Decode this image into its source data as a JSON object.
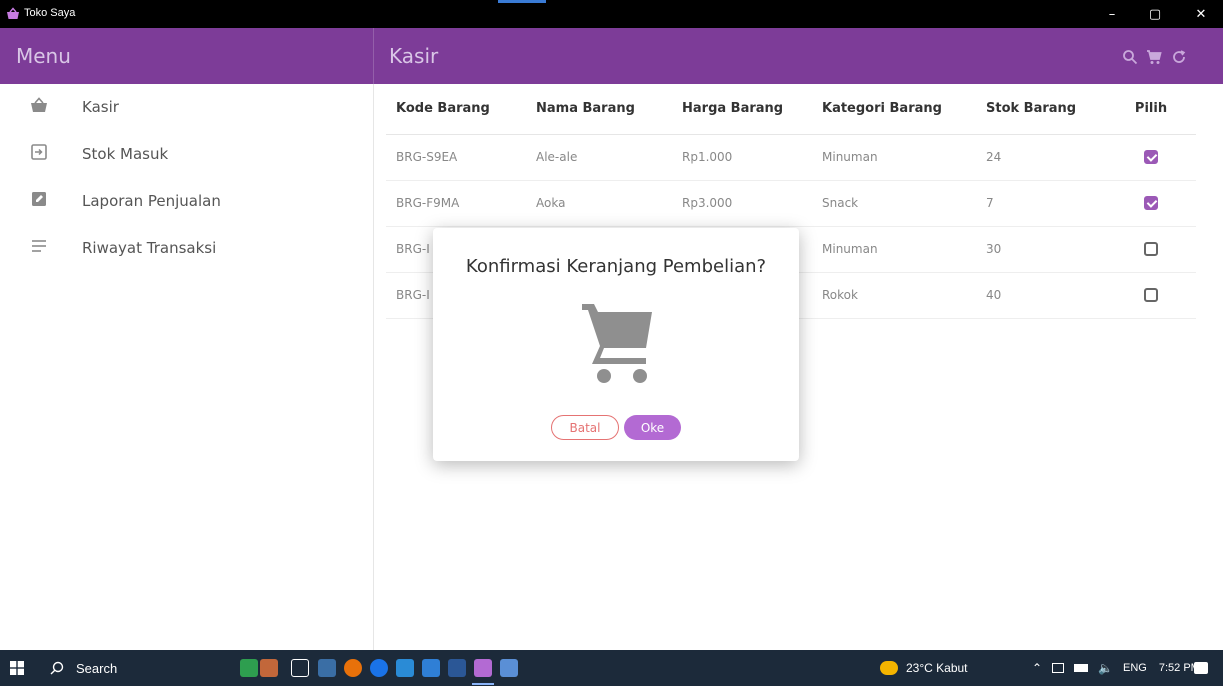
{
  "window": {
    "title": "Toko Saya",
    "minimize_glyph": "–",
    "maximize_glyph": "▢",
    "close_glyph": "✕"
  },
  "appbar": {
    "menu_title": "Menu",
    "page_title": "Kasir",
    "actions": [
      "search-icon",
      "cart-icon",
      "refresh-icon"
    ]
  },
  "sidebar": {
    "items": [
      {
        "label": "Kasir",
        "icon": "basket-icon"
      },
      {
        "label": "Stok Masuk",
        "icon": "login-icon"
      },
      {
        "label": "Laporan Penjualan",
        "icon": "edit-note-icon"
      },
      {
        "label": "Riwayat Transaksi",
        "icon": "list-icon"
      }
    ]
  },
  "table": {
    "headers": [
      "Kode Barang",
      "Nama Barang",
      "Harga Barang",
      "Kategori Barang",
      "Stok Barang",
      "Pilih"
    ],
    "rows": [
      {
        "kode": "BRG-S9EA",
        "nama": "Ale-ale",
        "harga": "Rp1.000",
        "kategori": "Minuman",
        "stok": "24",
        "checked": true
      },
      {
        "kode": "BRG-F9MA",
        "nama": "Aoka",
        "harga": "Rp3.000",
        "kategori": "Snack",
        "stok": "7",
        "checked": true
      },
      {
        "kode": "BRG-I",
        "nama": "",
        "harga": "",
        "kategori": "Minuman",
        "stok": "30",
        "checked": false
      },
      {
        "kode": "BRG-I",
        "nama": "",
        "harga": "",
        "kategori": "Rokok",
        "stok": "40",
        "checked": false
      }
    ]
  },
  "dialog": {
    "title": "Konfirmasi Keranjang Pembelian?",
    "icon": "shopping-cart-icon",
    "cancel_label": "Batal",
    "ok_label": "Oke"
  },
  "taskbar": {
    "search_label": "Search",
    "weather": "23°C  Kabut",
    "language": "ENG",
    "time": "7:52 PM"
  },
  "colors": {
    "appbar": "#7d3c98",
    "accent": "#9b59b6",
    "ok_button": "#b36ad3",
    "cancel_border": "#e57373"
  }
}
